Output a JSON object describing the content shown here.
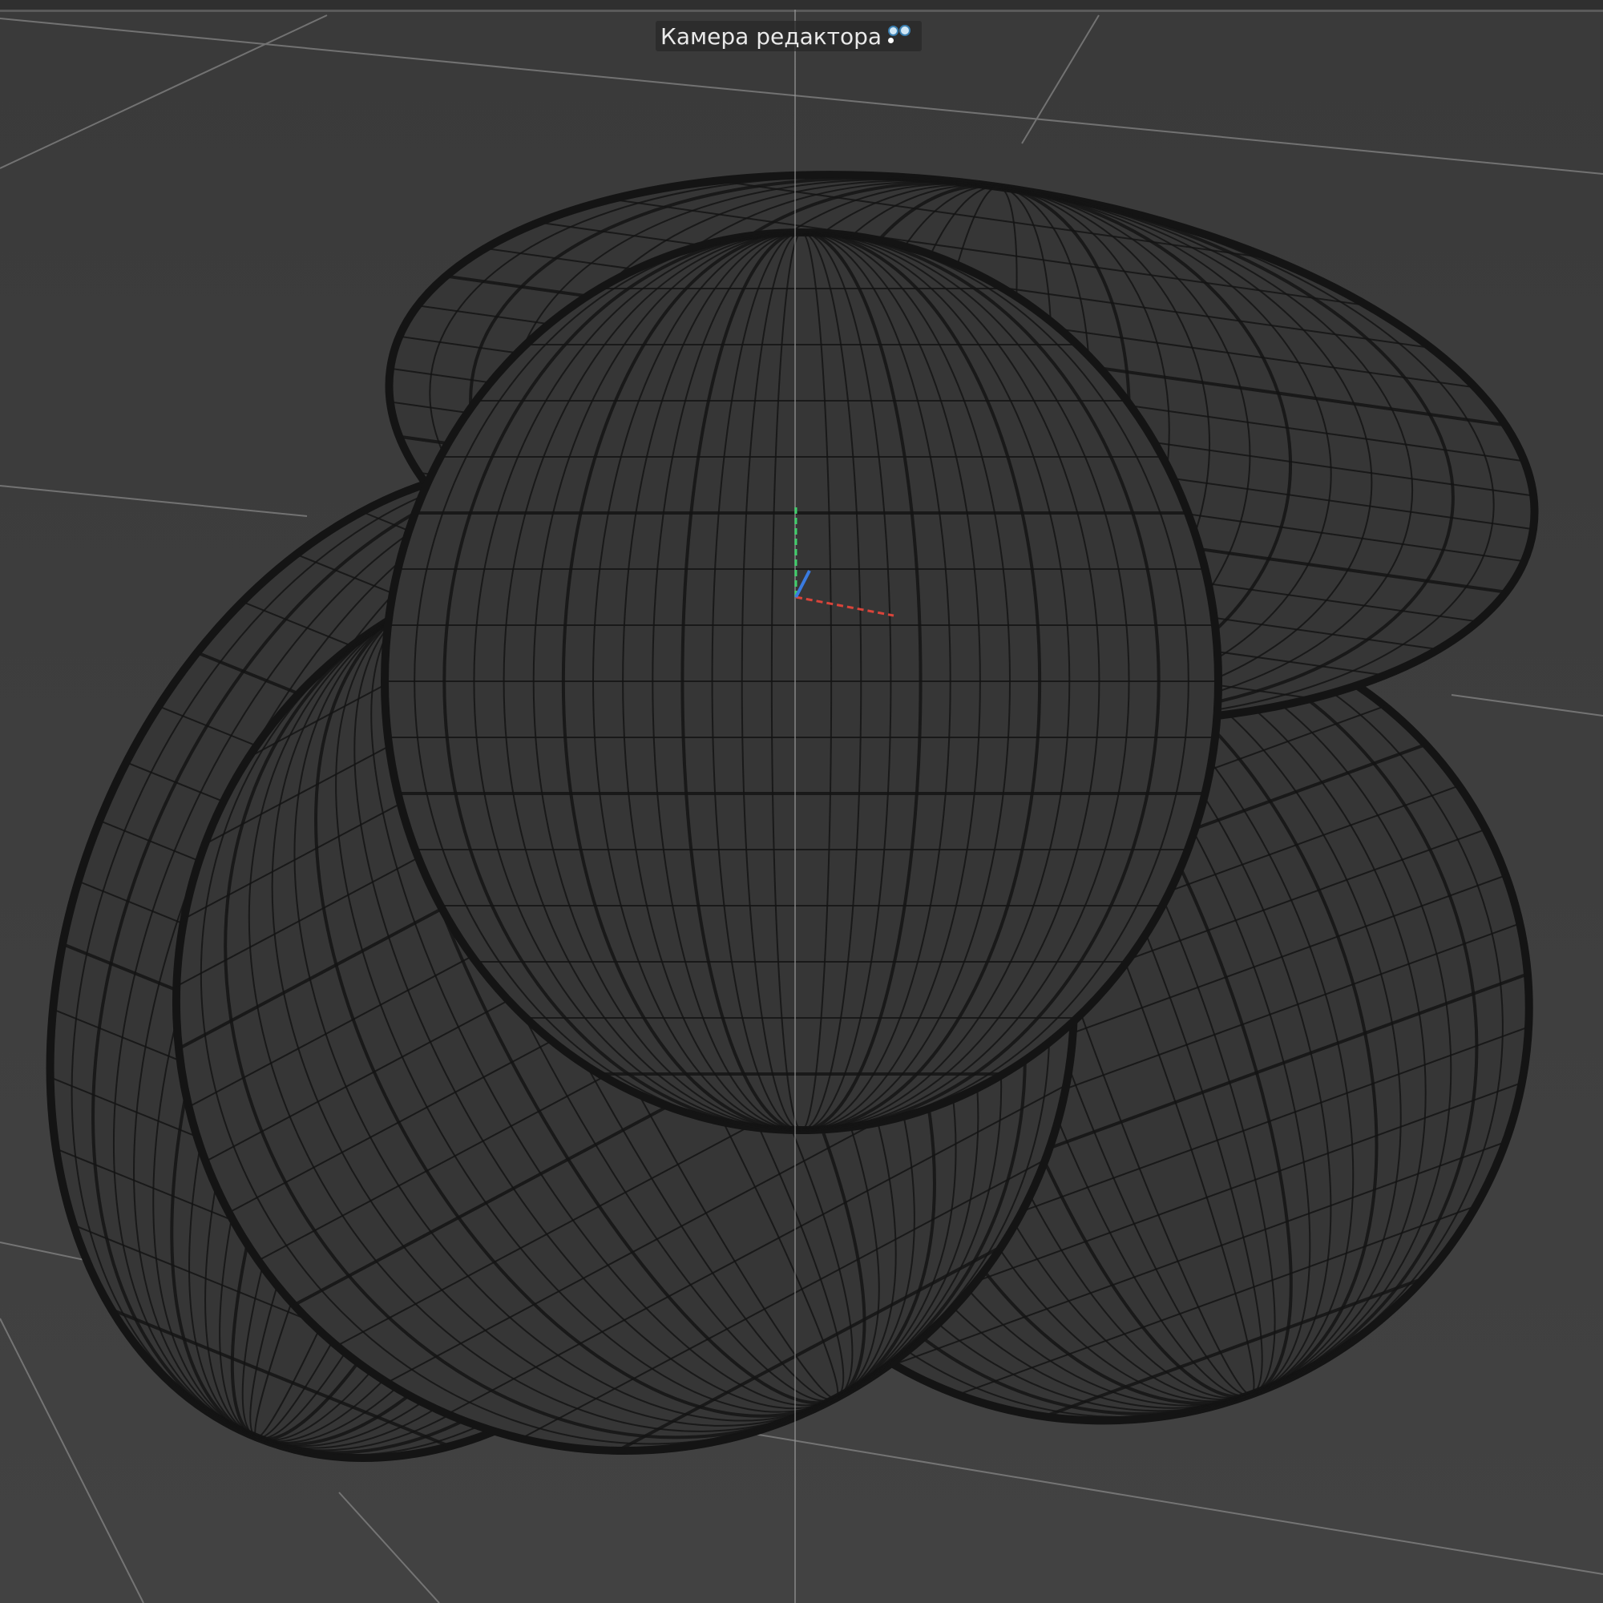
{
  "viewport": {
    "camera_label": "Камера редактора",
    "camera_icon": "camera-settings-icon",
    "view_mode": "wireframe"
  },
  "colors": {
    "background": "#3e3e3e",
    "grid": "#8a8a8a",
    "wire": "#141414",
    "axis_x": "#d9443a",
    "axis_y": "#3fcf6a",
    "axis_z": "#3a7be0"
  }
}
